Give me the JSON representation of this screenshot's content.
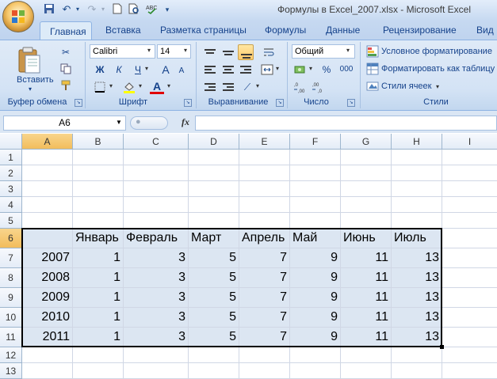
{
  "window": {
    "title": "Формулы в Excel_2007.xlsx - Microsoft Excel"
  },
  "quick_access": {
    "icons": [
      "save-icon",
      "undo-icon",
      "redo-icon",
      "new-icon",
      "print-preview-icon",
      "spelling-icon"
    ]
  },
  "tabs": [
    {
      "label": "Главная",
      "active": true
    },
    {
      "label": "Вставка"
    },
    {
      "label": "Разметка страницы"
    },
    {
      "label": "Формулы"
    },
    {
      "label": "Данные"
    },
    {
      "label": "Рецензирование"
    },
    {
      "label": "Вид"
    }
  ],
  "ribbon": {
    "clipboard": {
      "paste_label": "Вставить",
      "group_label": "Буфер обмена"
    },
    "font": {
      "font_name": "Calibri",
      "font_size": "14",
      "bold": "Ж",
      "italic": "К",
      "underline": "Ч",
      "grow": "A",
      "shrink": "A",
      "color_glyph": "A",
      "group_label": "Шрифт",
      "font_color": "#e00000",
      "fill_color": "#ffff00"
    },
    "alignment": {
      "group_label": "Выравнивание"
    },
    "number": {
      "format": "Общий",
      "percent": "%",
      "thousands": "000",
      "group_label": "Число"
    },
    "styles": {
      "conditional": "Условное форматирование",
      "format_table": "Форматировать как таблицу",
      "cell_styles": "Стили ячеек",
      "group_label": "Стили"
    }
  },
  "formula_bar": {
    "name_box": "A6",
    "fx": "fx",
    "formula": ""
  },
  "grid": {
    "columns": [
      "A",
      "B",
      "C",
      "D",
      "E",
      "F",
      "G",
      "H",
      "I"
    ],
    "rows": [
      "1",
      "2",
      "3",
      "4",
      "5",
      "6",
      "7",
      "8",
      "9",
      "10",
      "11",
      "12",
      "13"
    ],
    "selected_column": "A",
    "selected_row": "6",
    "table_header": [
      "",
      "Январь",
      "Февраль",
      "Март",
      "Апрель",
      "Май",
      "Июнь",
      "Июль"
    ],
    "table_rows": [
      [
        "2007",
        "1",
        "3",
        "5",
        "7",
        "9",
        "11",
        "13"
      ],
      [
        "2008",
        "1",
        "3",
        "5",
        "7",
        "9",
        "11",
        "13"
      ],
      [
        "2009",
        "1",
        "3",
        "5",
        "7",
        "9",
        "11",
        "13"
      ],
      [
        "2010",
        "1",
        "3",
        "5",
        "7",
        "9",
        "11",
        "13"
      ],
      [
        "2011",
        "1",
        "3",
        "5",
        "7",
        "9",
        "11",
        "13"
      ]
    ],
    "table_fill": "#dce6f2"
  }
}
